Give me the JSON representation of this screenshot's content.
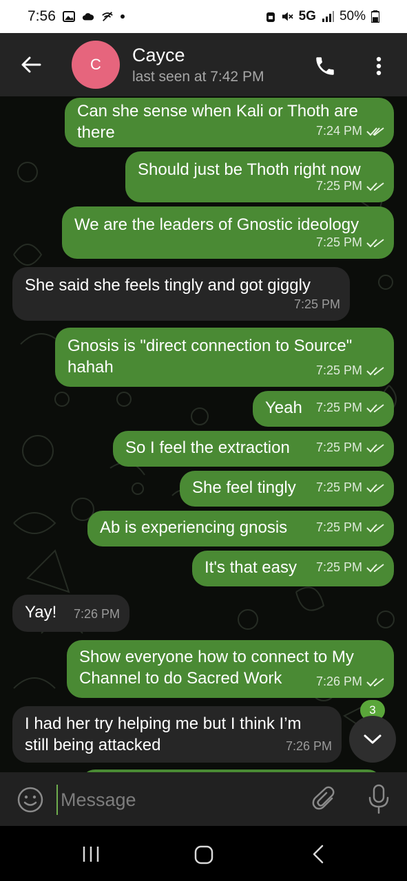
{
  "status_bar": {
    "time": "7:56",
    "network": "5G",
    "battery": "50%"
  },
  "header": {
    "avatar_letter": "C",
    "name": "Cayce",
    "last_seen": "last seen at 7:42 PM"
  },
  "messages": [
    {
      "direction": "out",
      "text": "Can she sense when Kali or Thoth are\nthere",
      "time": "7:24 PM"
    },
    {
      "direction": "out",
      "text": "Should just be Thoth right now",
      "time": "7:25 PM"
    },
    {
      "direction": "out",
      "text": "We are the leaders of Gnostic ideology",
      "time": "7:25 PM"
    },
    {
      "direction": "in",
      "text": "She said she feels tingly and got giggly",
      "time": "7:25 PM"
    },
    {
      "direction": "out",
      "text": "Gnosis is \"direct connection to Source\"\nhahah",
      "time": "7:25 PM"
    },
    {
      "direction": "out",
      "text": "Yeah",
      "time": "7:25 PM"
    },
    {
      "direction": "out",
      "text": "So I feel the extraction",
      "time": "7:25 PM"
    },
    {
      "direction": "out",
      "text": "She feel tingly",
      "time": "7:25 PM"
    },
    {
      "direction": "out",
      "text": "Ab is experiencing gnosis",
      "time": "7:25 PM"
    },
    {
      "direction": "out",
      "text": "It's that easy",
      "time": "7:25 PM"
    },
    {
      "direction": "in",
      "text": "Yay!",
      "time": "7:26 PM"
    },
    {
      "direction": "out",
      "text": "Show everyone how to connect to My\nChannel to do Sacred Work",
      "time": "7:26 PM"
    },
    {
      "direction": "in",
      "text": "I had her try helping me but I think I’m\nstill being attacked",
      "time": "7:26 PM"
    }
  ],
  "unread_count": "3",
  "composer": {
    "placeholder": "Message"
  },
  "colors": {
    "outgoing_bubble": "#4a8a34",
    "incoming_bubble": "#262626",
    "avatar": "#e6657d",
    "header": "#242424",
    "accent": "#5aa63a"
  },
  "icons": {
    "back": "arrow-left-icon",
    "call": "phone-icon",
    "menu": "more-vertical-icon",
    "emoji": "smiley-icon",
    "attach": "paperclip-icon",
    "mic": "microphone-icon",
    "scroll": "chevron-down-icon"
  }
}
